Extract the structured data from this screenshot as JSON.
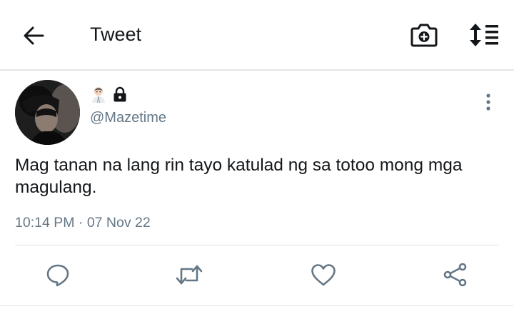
{
  "header": {
    "title": "Tweet",
    "back_icon": "arrow-left-icon",
    "camera_icon": "camera-plus-icon",
    "sort_icon": "sort-list-icon"
  },
  "tweet": {
    "author": {
      "display_name_emojis": [
        "person-emoji-icon",
        "lock-icon"
      ],
      "handle": "@Mazetime"
    },
    "text": "Mag tanan na lang rin tayo katulad ng sa totoo mong mga magulang.",
    "time": "10:14 PM",
    "separator": "·",
    "date": "07 Nov 22"
  },
  "actions": [
    {
      "icon": "reply-icon"
    },
    {
      "icon": "retweet-icon"
    },
    {
      "icon": "like-icon"
    },
    {
      "icon": "share-icon"
    }
  ],
  "colors": {
    "text_primary": "#14171a",
    "text_secondary": "#657786",
    "divider": "#e1e4e8"
  }
}
